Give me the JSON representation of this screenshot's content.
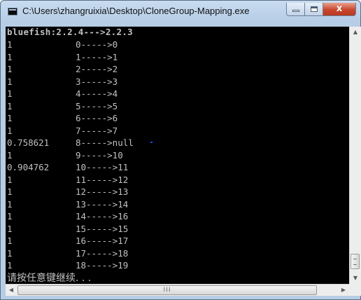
{
  "window": {
    "title": "C:\\Users\\zhangruixia\\Desktop\\CloneGroup-Mapping.exe",
    "icon": "console-app-icon",
    "buttons": {
      "minimize": "minimize",
      "maximize": "maximize",
      "close": "x"
    }
  },
  "console": {
    "header": "bluefish:2.2.4--->2.2.3",
    "rows": [
      {
        "score": "1",
        "mapping": "0----->0"
      },
      {
        "score": "1",
        "mapping": "1----->1"
      },
      {
        "score": "1",
        "mapping": "2----->2"
      },
      {
        "score": "1",
        "mapping": "3----->3"
      },
      {
        "score": "1",
        "mapping": "4----->4"
      },
      {
        "score": "1",
        "mapping": "5----->5"
      },
      {
        "score": "1",
        "mapping": "6----->6"
      },
      {
        "score": "1",
        "mapping": "7----->7"
      },
      {
        "score": "0.758621",
        "mapping": "8----->null"
      },
      {
        "score": "1",
        "mapping": "9----->10"
      },
      {
        "score": "0.904762",
        "mapping": "10----->11"
      },
      {
        "score": "1",
        "mapping": "11----->12"
      },
      {
        "score": "1",
        "mapping": "12----->13"
      },
      {
        "score": "1",
        "mapping": "13----->14"
      },
      {
        "score": "1",
        "mapping": "14----->16"
      },
      {
        "score": "1",
        "mapping": "15----->15"
      },
      {
        "score": "1",
        "mapping": "16----->17"
      },
      {
        "score": "1",
        "mapping": "17----->18"
      },
      {
        "score": "1",
        "mapping": "18----->19"
      }
    ],
    "prompt": "请按任意键继续. . ."
  },
  "scrollbars": {
    "vertical": {
      "up_arrow": "▲",
      "down_arrow": "▼"
    },
    "horizontal": {
      "left_arrow": "◀",
      "right_arrow": "▶",
      "grip": "III"
    }
  },
  "colors": {
    "console_bg": "#000000",
    "console_fg": "#c0c0c0",
    "close_red": "#c9462e"
  }
}
